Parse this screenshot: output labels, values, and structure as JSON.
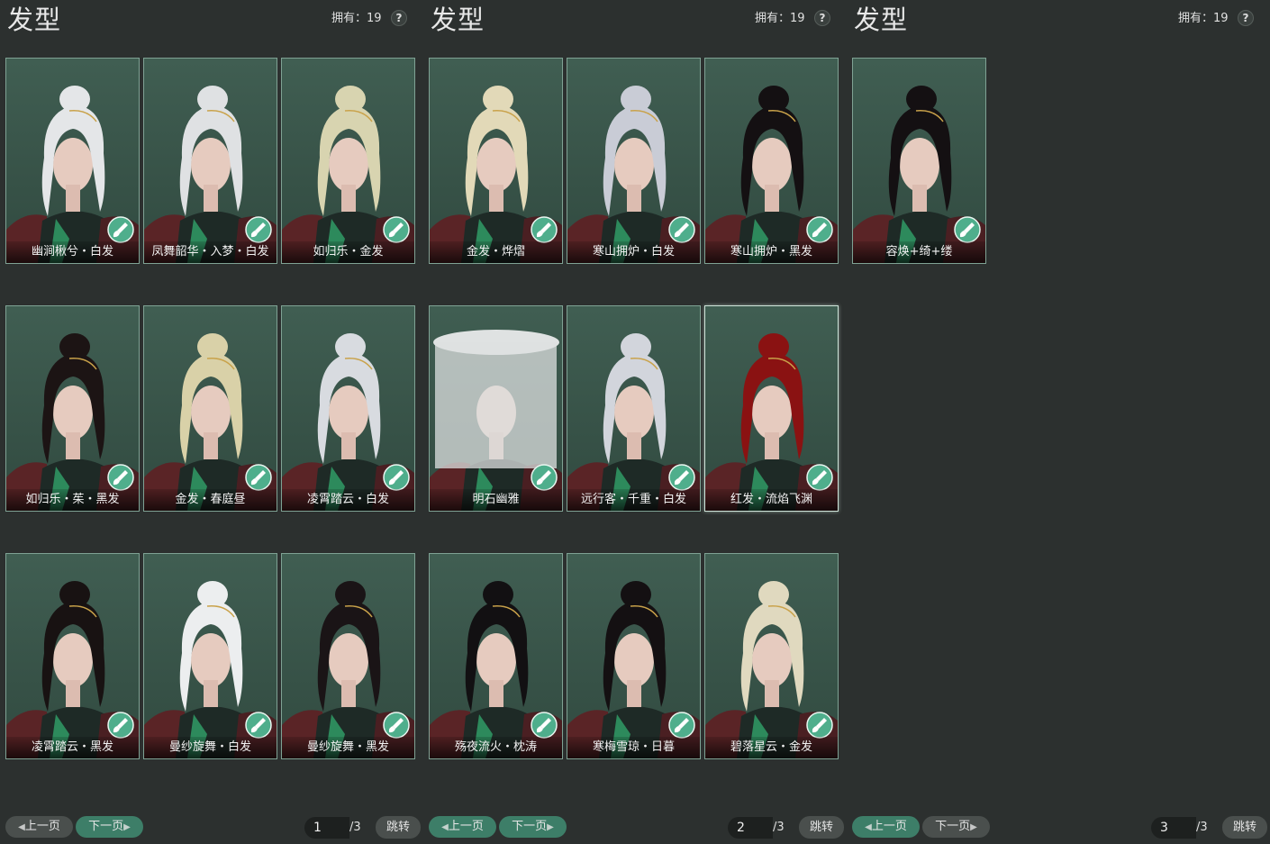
{
  "colors": {
    "background": "#2b2f2e",
    "card_bg": "#3b584c",
    "card_border": "#7fa294",
    "accent_green": "#3d7e68",
    "brush_icon": "#4fae8c"
  },
  "panels": [
    {
      "title": "发型",
      "owned_label": "拥有：19",
      "help_label": "?",
      "cards": [
        {
          "label": "幽涧楸兮・白发",
          "hair": "#e4e6e8"
        },
        {
          "label": "凤舞韶华・入梦・白发",
          "hair": "#dfe1e3"
        },
        {
          "label": "如归乐・金发",
          "hair": "#d8d4b0"
        },
        {
          "label": "如归乐・茱・黑发",
          "hair": "#1c1414"
        },
        {
          "label": "金发・春庭昼",
          "hair": "#d9d1a8"
        },
        {
          "label": "凌霄踏云・白发",
          "hair": "#d8dbe0"
        },
        {
          "label": "凌霄踏云・黑发",
          "hair": "#181212"
        },
        {
          "label": "曼纱旋舞・白发",
          "hair": "#eceeef"
        },
        {
          "label": "曼纱旋舞・黑发",
          "hair": "#1a1416"
        }
      ],
      "prev_label": "上一页",
      "next_label": "下一页",
      "page": "1",
      "total": "/3",
      "jump_label": "跳转"
    },
    {
      "title": "发型",
      "owned_label": "拥有：19",
      "help_label": "?",
      "cards": [
        {
          "label": "金发・烨熠",
          "hair": "#e2d9b8"
        },
        {
          "label": "寒山拥炉・白发",
          "hair": "#c9ccd6"
        },
        {
          "label": "寒山拥炉・黑发",
          "hair": "#141012"
        },
        {
          "label": "明石幽雅",
          "hair": "#d3d6d6"
        },
        {
          "label": "远行客・千重・白发",
          "hair": "#d2d5dc"
        },
        {
          "label": "红发・流焰飞渊",
          "hair": "#8a1212"
        },
        {
          "label": "殇夜流火・枕涛",
          "hair": "#121012"
        },
        {
          "label": "寒梅雪琼・日暮",
          "hair": "#141012"
        },
        {
          "label": "碧落星云・金发",
          "hair": "#e0d9bf"
        }
      ],
      "prev_label": "上一页",
      "next_label": "下一页",
      "page": "2",
      "total": "/3",
      "jump_label": "跳转"
    },
    {
      "title": "发型",
      "owned_label": "拥有：19",
      "help_label": "?",
      "cards": [
        {
          "label": "容焕+绮+缕",
          "hair": "#141012"
        }
      ],
      "prev_label": "上一页",
      "next_label": "下一页",
      "page": "3",
      "total": "/3",
      "jump_label": "跳转"
    }
  ]
}
